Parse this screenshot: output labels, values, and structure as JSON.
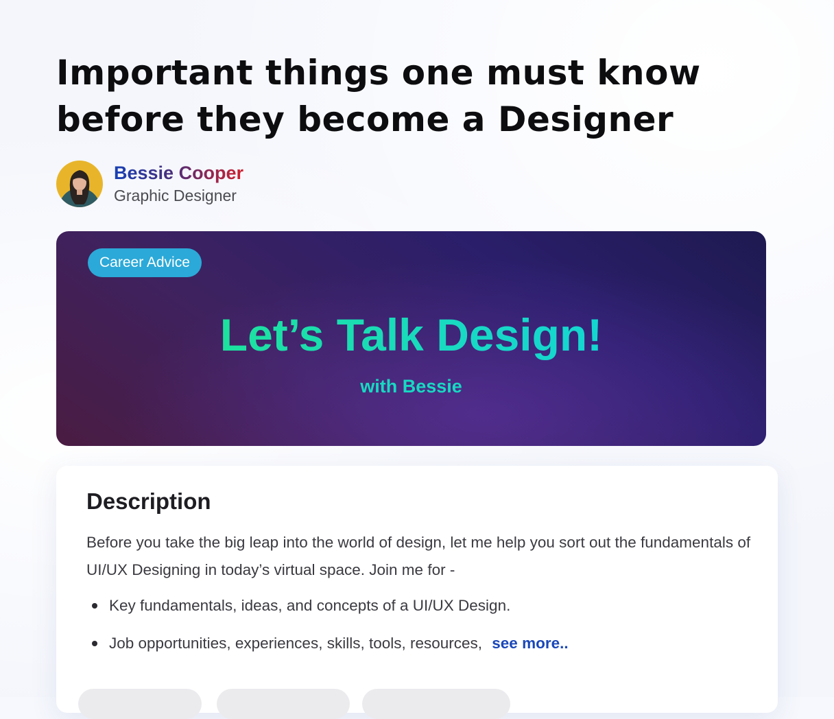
{
  "article": {
    "title": "Important things one must know before they become a Designer"
  },
  "author": {
    "name": "Bessie Cooper",
    "role": "Graphic Designer"
  },
  "banner": {
    "tag": "Career Advice",
    "title": "Let’s Talk Design!",
    "subtitle": "with Bessie"
  },
  "description": {
    "heading": "Description",
    "paragraph": "Before you take the big leap into the world of design, let me help you sort out the fundamentals of UI/UX Designing in today’s virtual space. Join me for -",
    "bullets": [
      "Key fundamentals, ideas, and concepts of a UI/UX Design.",
      "Job opportunities, experiences, skills, tools, resources,"
    ],
    "see_more": "see more.."
  },
  "colors": {
    "accent_teal": "#17d9c2",
    "tag_blue": "#2ba9d8",
    "link_blue": "#1a47b8",
    "banner_dark": "#2a1e6a"
  }
}
